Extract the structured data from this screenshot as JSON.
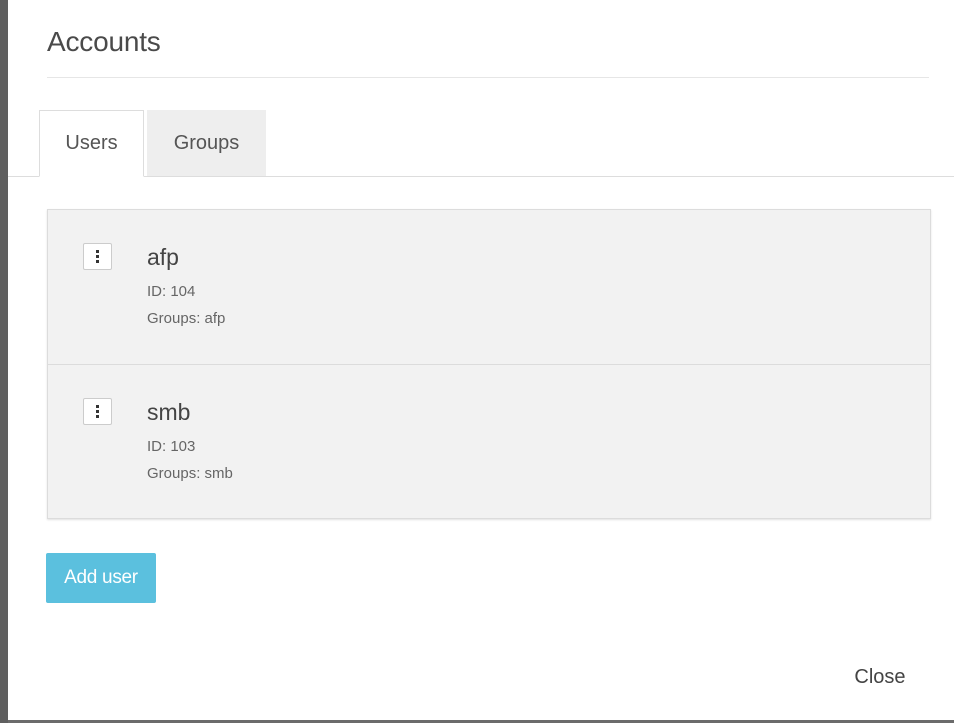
{
  "dialog": {
    "title": "Accounts",
    "close_label": "Close"
  },
  "tabs": [
    {
      "label": "Users",
      "active": true
    },
    {
      "label": "Groups",
      "active": false
    }
  ],
  "users": [
    {
      "name": "afp",
      "id": "ID: 104",
      "groups": "Groups: afp"
    },
    {
      "name": "smb",
      "id": "ID: 103",
      "groups": "Groups: smb"
    }
  ],
  "actions": {
    "add_user_label": "Add user"
  },
  "colors": {
    "add_button": "#5bc0de",
    "list_background": "#f2f2f2",
    "inactive_tab": "#eeeeee"
  },
  "icons": {
    "row_menu": "kebab-menu-icon"
  }
}
